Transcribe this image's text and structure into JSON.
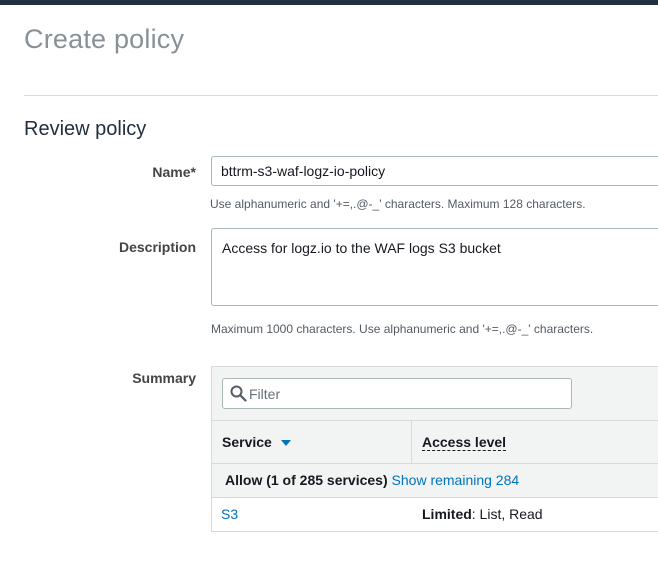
{
  "page": {
    "title": "Create policy",
    "section_title": "Review policy"
  },
  "name_field": {
    "label": "Name*",
    "value": "bttrm-s3-waf-logz-io-policy",
    "hint": "Use alphanumeric and '+=,.@-_' characters. Maximum 128 characters."
  },
  "description_field": {
    "label": "Description",
    "value": "Access for logz.io to the WAF logs S3 bucket",
    "hint": "Maximum 1000 characters. Use alphanumeric and '+=,.@-_' characters."
  },
  "summary": {
    "label": "Summary",
    "filter_placeholder": "Filter",
    "columns": {
      "service": "Service",
      "access_level": "Access level"
    },
    "group": {
      "label": "Allow (1 of 285 services)",
      "link": "Show remaining 284"
    },
    "rows": [
      {
        "service": "S3",
        "access_level": "Limited",
        "access_detail": ": List, Read"
      }
    ]
  },
  "colors": {
    "accent": "#0073bb",
    "topbar": "#232f3e"
  }
}
